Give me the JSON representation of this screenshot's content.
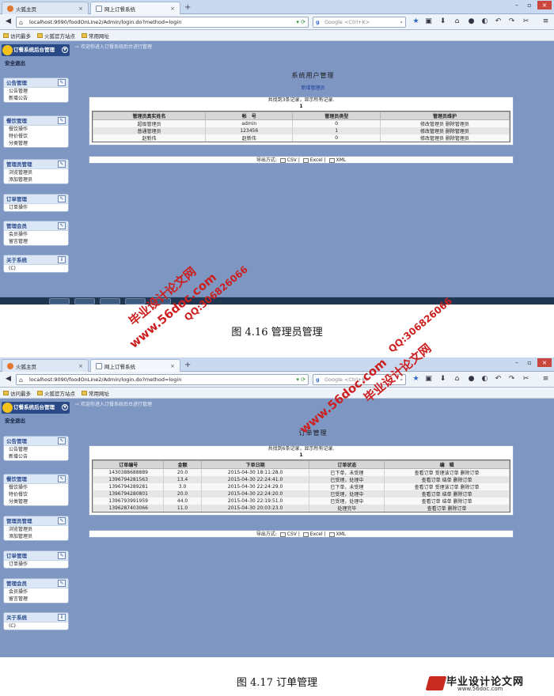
{
  "browser": {
    "tabs": [
      "火狐主页",
      "网上订餐系统"
    ],
    "url": "localhost:9090/foodOnLine2/Admin/login.do?method=login",
    "search_placeholder": "Google <Ctrl+K>",
    "bookmarks": [
      "访问最多",
      "火狐官方站点",
      "常用网址"
    ]
  },
  "app": {
    "logo": "订餐系统后台管理",
    "logout": "安全退出",
    "welcome": "欢迎你进入订餐系统后台进行管理",
    "menus": [
      {
        "title": "公告管理",
        "items": [
          "公告管理",
          "新增公告"
        ]
      },
      {
        "title": "餐饮管理",
        "items": [
          "餐饮操作",
          "特价餐饮",
          "分类管理"
        ]
      },
      {
        "title": "管理员管理",
        "items": [
          "浏览管理员",
          "添加管理员"
        ]
      },
      {
        "title": "订单管理",
        "items": [
          "订单操作"
        ]
      },
      {
        "title": "管理会员",
        "items": [
          "会员操作",
          "留言管理"
        ]
      },
      {
        "title": "关于系统",
        "items": [
          "(C)"
        ]
      }
    ],
    "export": {
      "label": "导出方式:",
      "csv": "CSV",
      "excel": "Excel",
      "xml": "XML"
    }
  },
  "screen1": {
    "page_title": "系统用户管理",
    "add_link": "新增管理员",
    "found": "共找到3条记录，显示所有记录.",
    "page": "1",
    "columns": [
      "管理员真实姓名",
      "帐　号",
      "管理员类型",
      "管理员维护"
    ],
    "rows": [
      [
        "超级管理员",
        "admin",
        "0",
        "修改管理员 删除管理员"
      ],
      [
        "普通管理员",
        "123456",
        "1",
        "修改管理员 删除管理员"
      ],
      [
        "赵新伟",
        "赵新伟",
        "0",
        "修改管理员 删除管理员"
      ]
    ],
    "caption": "图 4.16  管理员管理"
  },
  "screen2": {
    "page_title": "订单管理",
    "found": "共找到6条记录，显示所有记录.",
    "page": "1",
    "columns": [
      "订单编号",
      "金额",
      "下单日期",
      "订单状态",
      "编　辑"
    ],
    "rows": [
      [
        "1430388688889",
        "20.0",
        "2015-04-30 18:11:28.0",
        "已下单，未受理",
        "查看订单 受理该订单 删除订单"
      ],
      [
        "1396794281563",
        "13.4",
        "2015-04-30 22:24:41.0",
        "已受理，处理中",
        "查看订单 结单 删除订单"
      ],
      [
        "1396794289281",
        "3.0",
        "2015-04-30 22:24:29.0",
        "已下单，未受理",
        "查看订单 受理该订单 删除订单"
      ],
      [
        "1396794280801",
        "20.0",
        "2015-04-30 22:24:20.0",
        "已受理，处理中",
        "查看订单 结单 删除订单"
      ],
      [
        "1396793991959",
        "44.0",
        "2015-04-30 22:19:51.0",
        "已受理，处理中",
        "查看订单 结单 删除订单"
      ],
      [
        "1396287403066",
        "11.0",
        "2015-04-30 20:03:23.0",
        "处理完毕",
        "查看订单 删除订单"
      ]
    ],
    "caption": "图 4.17  订单管理"
  },
  "watermarks": {
    "site": "www.56doc.com",
    "qq": "QQ:306826066",
    "name": "毕业设计论文网",
    "brand_title": "毕业设计论文网",
    "brand_url": "www.56doc.com"
  }
}
